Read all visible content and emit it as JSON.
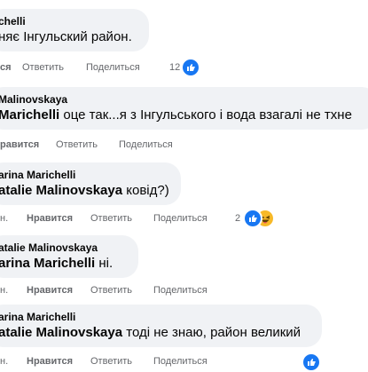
{
  "comments": [
    {
      "author": "chelli",
      "text": "няє Інгульский район.",
      "actions": {
        "like": "ся",
        "reply": "Ответить",
        "share": "Поделиться"
      },
      "reaction_count": "12"
    },
    {
      "author": "Malinovskaya",
      "mention": "Marichelli",
      "text": " оце так...я з Інгульського і вода взагалі не тхне",
      "actions": {
        "like": "равится",
        "reply": "Ответить",
        "share": "Поделиться"
      }
    },
    {
      "author": "arina Marichelli",
      "mention": "atalie Malinovskaya",
      "text": " ковід?)",
      "actions": {
        "time": "н.",
        "like": "Нравится",
        "reply": "Ответить",
        "share": "Поделиться"
      },
      "reaction_count": "2"
    },
    {
      "author": "atalie Malinovskaya",
      "mention": "arina Marichelli",
      "text": " ні.",
      "actions": {
        "time": "н.",
        "like": "Нравится",
        "reply": "Ответить",
        "share": "Поделиться"
      }
    },
    {
      "author": "arina Marichelli",
      "mention": "atalie Malinovskaya",
      "text": " тоді не знаю, район великий",
      "actions": {
        "time": "н.",
        "like": "Нравится",
        "reply": "Ответить",
        "share": "Поделиться"
      }
    }
  ],
  "colors": {
    "bubble": "#f0f2f5",
    "meta": "#65676b",
    "like": "#1877f2",
    "haha": "#f7b928"
  },
  "icons": [
    "like-reaction-icon",
    "haha-reaction-icon"
  ]
}
